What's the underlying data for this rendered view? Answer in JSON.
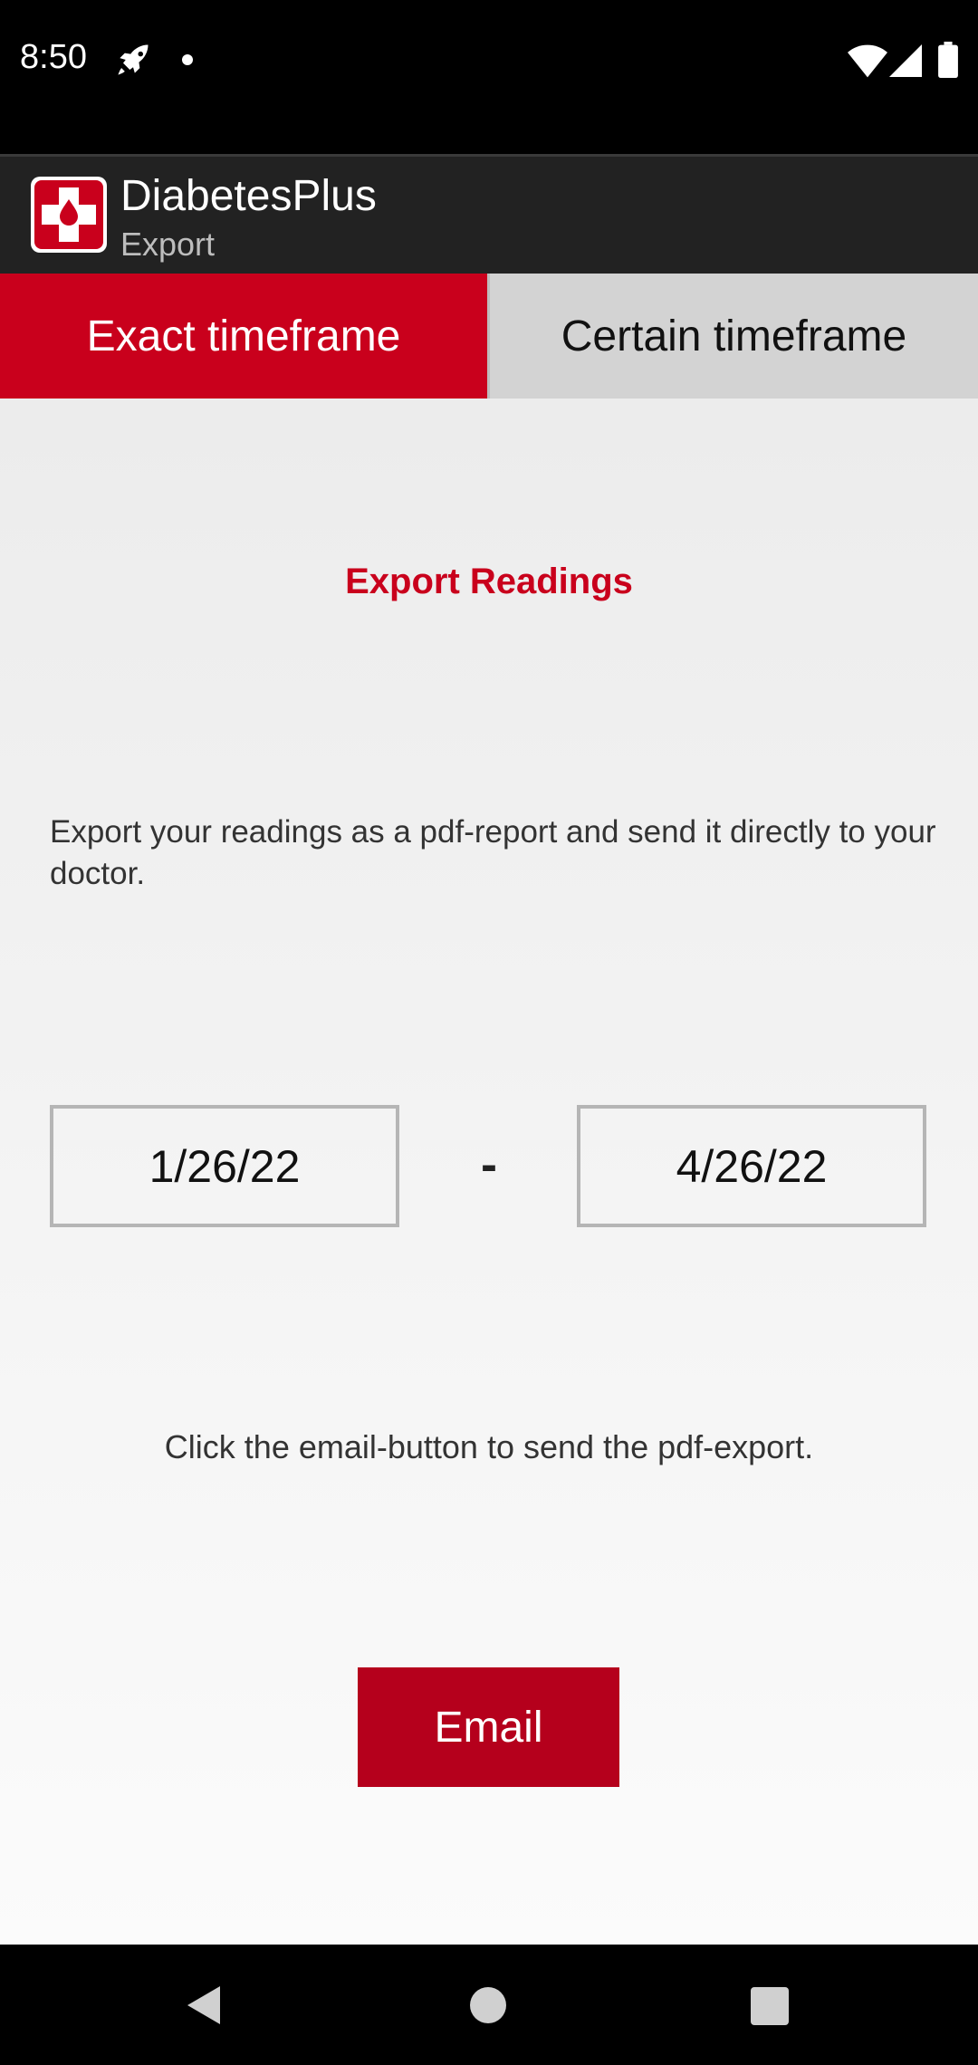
{
  "status_bar": {
    "time": "8:50",
    "icons": [
      "rocket-icon",
      "notification-dot-icon",
      "wifi-icon",
      "cell-signal-icon",
      "battery-icon"
    ]
  },
  "app_bar": {
    "title": "DiabetesPlus",
    "subtitle": "Export",
    "icon": "app-logo-blood-drop-cross-icon"
  },
  "tabs": [
    {
      "label": "Exact timeframe",
      "active": true
    },
    {
      "label": "Certain timeframe",
      "active": false
    }
  ],
  "main": {
    "heading": "Export Readings",
    "description": "Export your readings as a pdf-report and send it directly to your doctor.",
    "date_from": "1/26/22",
    "date_separator": "-",
    "date_to": "4/26/22",
    "hint": "Click the email-button to send the pdf-export.",
    "email_button": "Email"
  },
  "nav_bar": {
    "icons": [
      "back-icon",
      "home-icon",
      "recent-apps-icon"
    ]
  },
  "colors": {
    "accent": "#c9001c",
    "button": "#b5001c",
    "app_bar": "#222222",
    "inactive_tab": "#d3d3d3"
  }
}
